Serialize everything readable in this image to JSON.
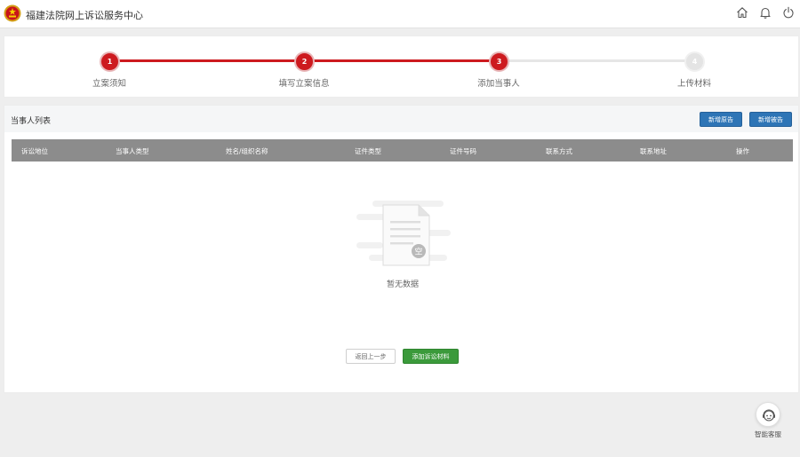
{
  "header": {
    "title": "福建法院网上诉讼服务中心",
    "icons": [
      "court-emblem-icon",
      "home-icon",
      "bell-icon",
      "power-icon"
    ]
  },
  "steps": [
    {
      "number": "1",
      "label": "立案须知",
      "active": true
    },
    {
      "number": "2",
      "label": "填写立案信息",
      "active": true
    },
    {
      "number": "3",
      "label": "添加当事人",
      "active": true
    },
    {
      "number": "4",
      "label": "上传材料",
      "active": false
    }
  ],
  "party_list": {
    "title": "当事人列表",
    "add_plaintiff_label": "新增原告",
    "add_defendant_label": "新增被告",
    "columns": [
      "诉讼地位",
      "当事人类型",
      "姓名/组织名称",
      "证件类型",
      "证件号码",
      "联系方式",
      "联系地址",
      "操作"
    ],
    "empty_badge": "空",
    "empty_text": "暂无数据"
  },
  "footer_actions": {
    "back_label": "返回上一步",
    "add_materials_label": "添加诉讼材料"
  },
  "customer_service": {
    "label": "智能客服",
    "icon": "robot-service-icon"
  },
  "colors": {
    "accent_red": "#cd1a1f",
    "primary_blue": "#2e75b6",
    "success_green": "#3b9a3b",
    "table_header_gray": "#8c8c8c"
  }
}
